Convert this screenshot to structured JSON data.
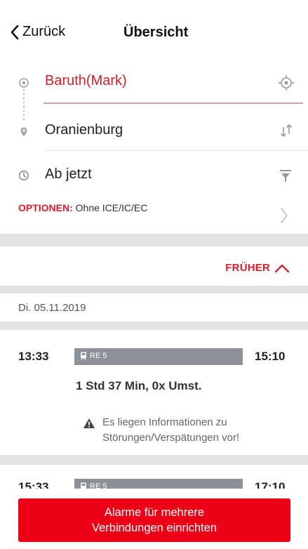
{
  "header": {
    "back_label": "Zurück",
    "title": "Übersicht"
  },
  "search": {
    "from": "Baruth(Mark)",
    "to": "Oranienburg",
    "time": "Ab jetzt",
    "options_label": "OPTIONEN:",
    "options_value": "Ohne ICE/IC/EC"
  },
  "earlier_label": "FRÜHER",
  "date_label": "Di. 05.11.2019",
  "connections": [
    {
      "departure": "13:33",
      "arrival": "15:10",
      "train": "RE 5",
      "duration": "1 Std 37 Min,  0x Umst.",
      "notice_line1": "Es liegen Informationen zu",
      "notice_line2": "Störungen/Verspätungen vor!"
    },
    {
      "departure": "15:33",
      "arrival": "17:10",
      "train": "RE 5"
    }
  ],
  "alarm_button": {
    "line1": "Alarme für mehrere",
    "line2": "Verbindungen einrichten"
  },
  "colors": {
    "accent": "#d21f2c",
    "button": "#ec0016",
    "train_bar": "#8c9198",
    "separator": "#e3e3e3"
  },
  "icons": [
    "chevron-left-icon",
    "origin-circle-icon",
    "destination-pin-icon",
    "clock-icon",
    "location-target-icon",
    "swap-icon",
    "filter-icon",
    "chevron-right-icon",
    "chevron-up-icon",
    "train-icon",
    "warning-icon"
  ]
}
